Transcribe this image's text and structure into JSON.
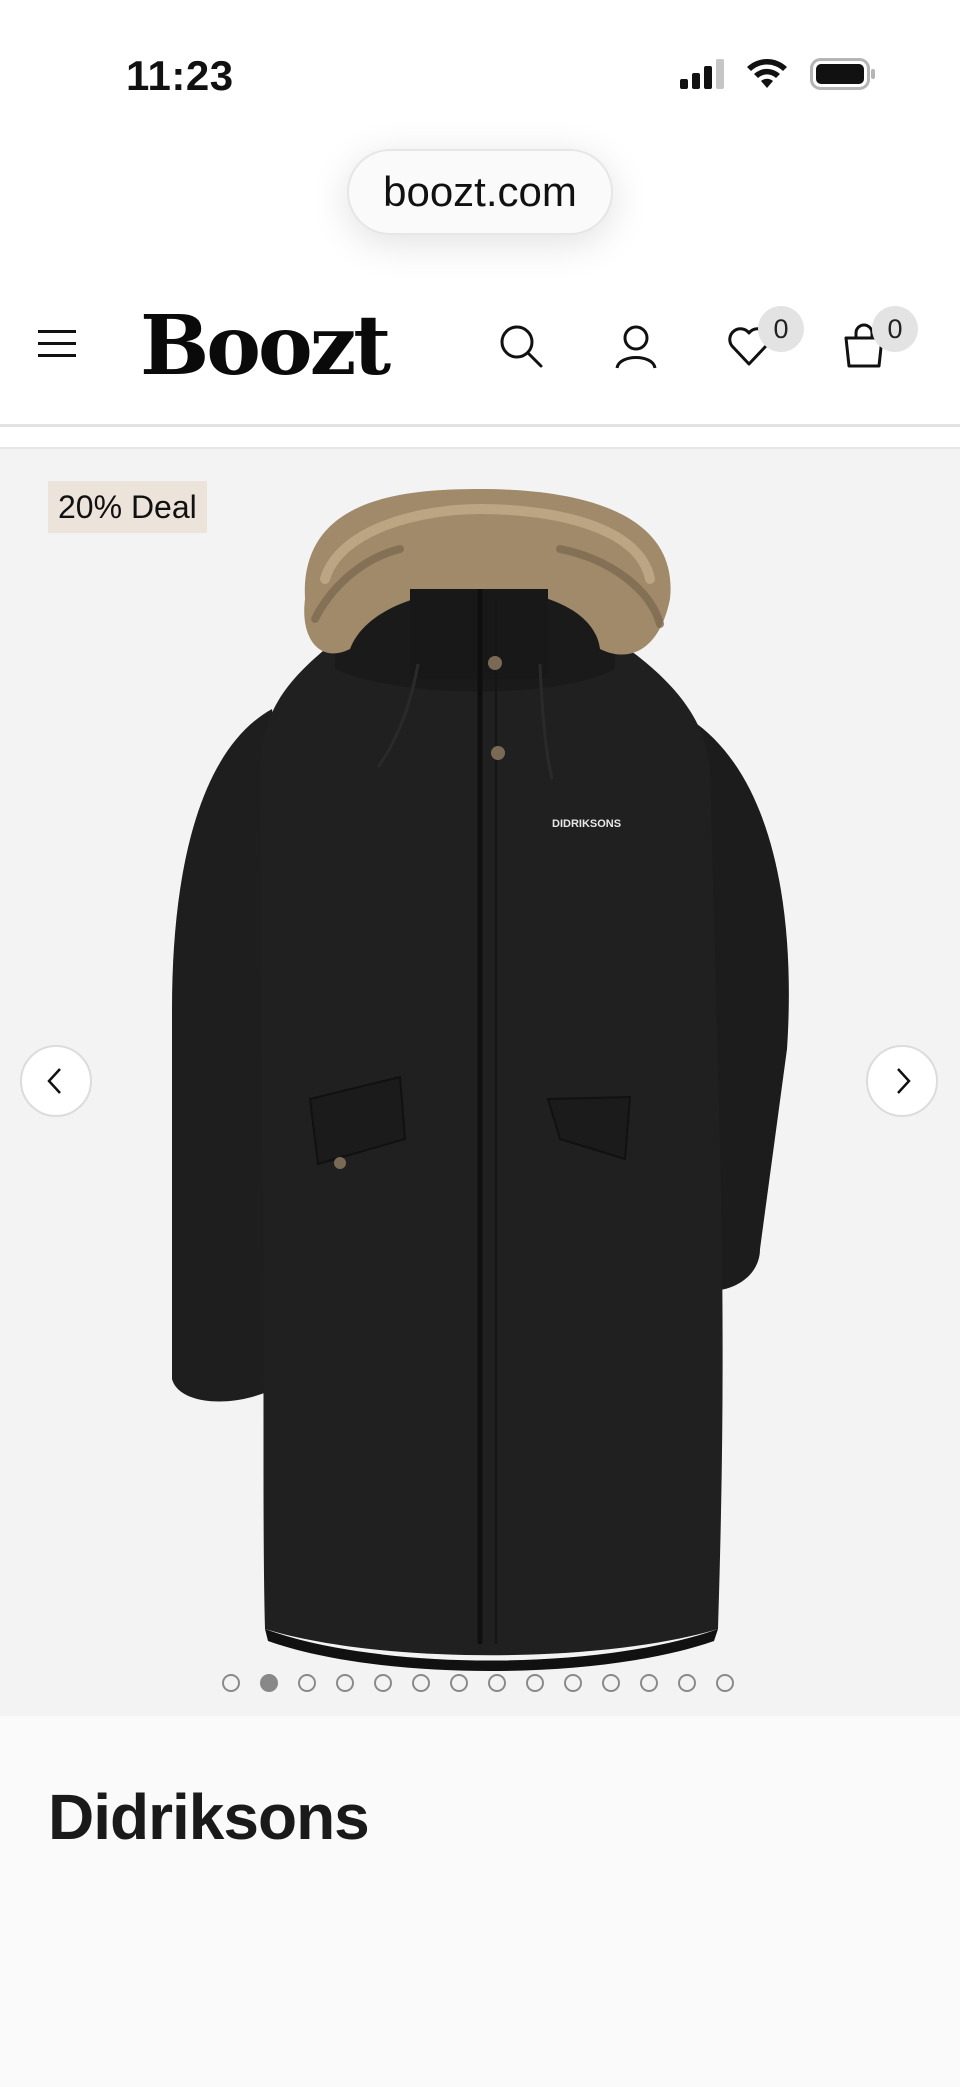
{
  "status_bar": {
    "time": "11:23",
    "icons": [
      "signal-icon",
      "wifi-icon",
      "battery-icon"
    ]
  },
  "browser": {
    "url": "boozt.com"
  },
  "header": {
    "logo": "Boozt",
    "icons": [
      "menu-icon",
      "search-icon",
      "account-icon",
      "heart-icon",
      "bag-icon"
    ],
    "wishlist_count": "0",
    "cart_count": "0"
  },
  "gallery": {
    "deal_badge": "20% Deal",
    "product_print": "DIDRIKSONS",
    "dots_total": 14,
    "active_dot": 2,
    "prev_icon": "chevron-left-icon",
    "next_icon": "chevron-right-icon"
  },
  "product": {
    "brand": "Didriksons"
  },
  "colors": {
    "deal_badge_bg": "#ece4da",
    "gallery_bg": "#f3f3f3",
    "coat": "#1e1e1e",
    "fur": "#a08a6a"
  }
}
